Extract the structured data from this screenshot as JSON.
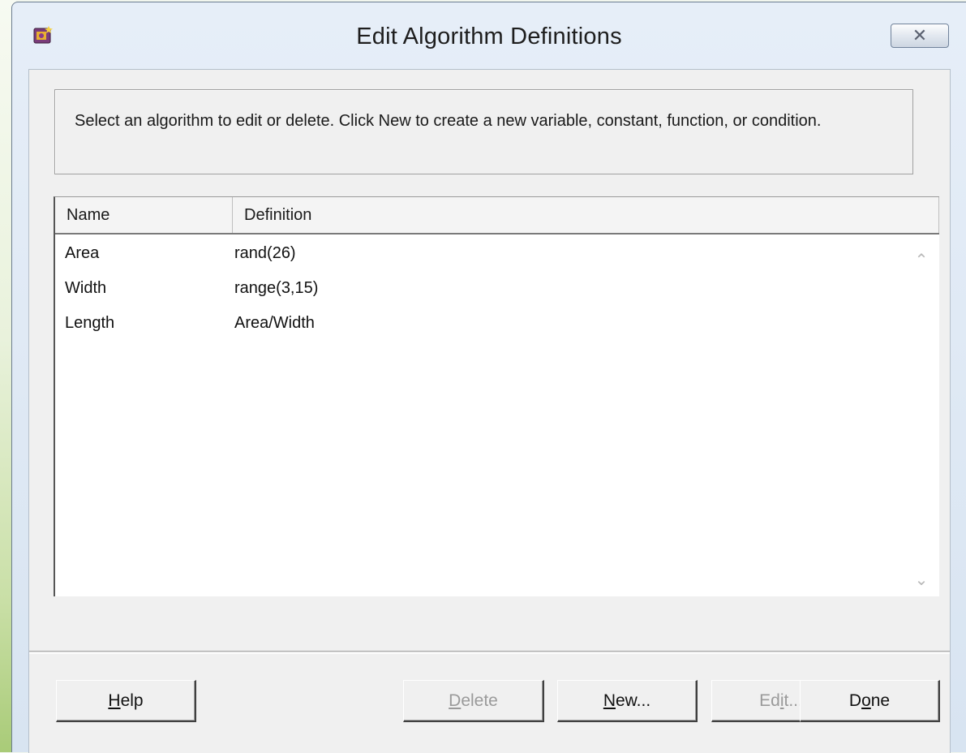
{
  "window": {
    "title": "Edit Algorithm Definitions",
    "close_glyph": "✕",
    "app_icon": "app-icon"
  },
  "instructions": "Select an algorithm to edit or delete. Click New to create a new variable, constant, function, or condition.",
  "table": {
    "columns": [
      "Name",
      "Definition"
    ],
    "rows": [
      {
        "name": "Area",
        "definition": "rand(26)"
      },
      {
        "name": "Width",
        "definition": "range(3,15)"
      },
      {
        "name": "Length",
        "definition": "Area/Width"
      }
    ],
    "scroll_up_glyph": "⌃",
    "scroll_down_glyph": "⌄"
  },
  "buttons": {
    "help": {
      "mnemonic": "H",
      "rest": "elp",
      "enabled": true
    },
    "delete": {
      "mnemonic": "D",
      "rest": "elete",
      "enabled": false
    },
    "new": {
      "mnemonic": "N",
      "rest": "ew...",
      "enabled": true
    },
    "edit": {
      "pre": "Ed",
      "mnemonic": "i",
      "rest": "t...",
      "enabled": false
    },
    "done": {
      "pre": "D",
      "mnemonic": "o",
      "rest": "ne",
      "enabled": true
    }
  }
}
